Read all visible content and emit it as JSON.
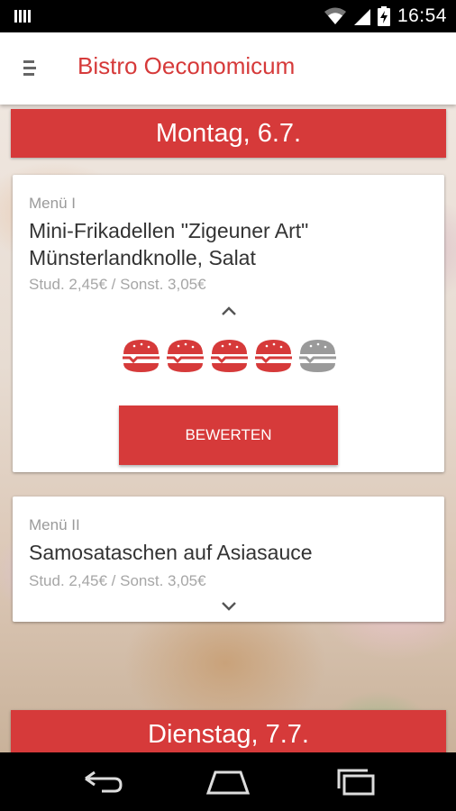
{
  "status_bar": {
    "time": "16:54"
  },
  "app_bar": {
    "title": "Bistro Oeconomicum"
  },
  "days": [
    {
      "header": "Montag, 6.7.",
      "menus": [
        {
          "label": "Menü I",
          "meal_lines": [
            "Mini-Frikadellen \"Zigeuner Art\"",
            "Münsterlandknolle, Salat"
          ],
          "price": "Stud. 2,45€ / Sonst. 3,05€",
          "expanded": true,
          "rating": 4,
          "rating_max": 5,
          "rate_button_label": "BEWERTEN"
        },
        {
          "label": "Menü II",
          "meal_lines": [
            "Samosataschen auf Asiasauce"
          ],
          "price": "Stud. 2,45€ / Sonst. 3,05€",
          "expanded": false
        }
      ]
    },
    {
      "header": "Dienstag, 7.7."
    }
  ],
  "colors": {
    "accent": "#d63a3a",
    "rating_inactive": "#9a9a9a"
  },
  "icons": [
    "drawer-menu-icon",
    "wifi-icon",
    "signal-icon",
    "battery-charging-icon",
    "chevron-up-icon",
    "chevron-down-icon",
    "burger-rating-icon",
    "back-icon",
    "home-icon",
    "recent-apps-icon"
  ]
}
